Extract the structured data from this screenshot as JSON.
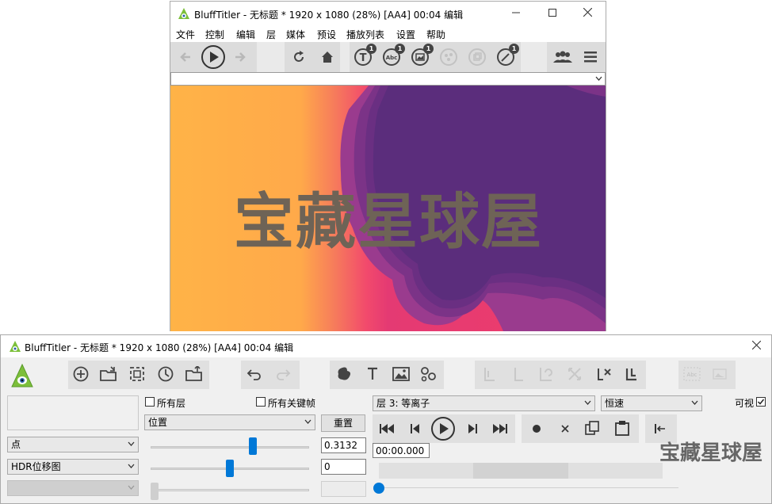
{
  "preview_window": {
    "title": "BluffTitler - 无标题 * 1920 x 1080 (28%) [AA4] 00:04 编辑",
    "menu": [
      "文件",
      "控制",
      "编辑",
      "层",
      "媒体",
      "预设",
      "播放列表",
      "设置",
      "帮助"
    ],
    "toolbar_badges": [
      "1",
      "1",
      "1",
      "1"
    ],
    "combo_value": ""
  },
  "watermark": "宝藏星球屋",
  "control_window": {
    "title": "BluffTitler - 无标题 * 1920 x 1080 (28%) [AA4] 00:04 编辑",
    "all_layers_label": "所有层",
    "all_keyframes_label": "所有关键帧",
    "property_select": "位置",
    "reset_button": "重置",
    "point_select": "点",
    "hdr_select": "HDR位移图",
    "value1": "0.3132",
    "value2": "0",
    "slider1_fraction": 0.65,
    "slider2_fraction": 0.5,
    "layer_select": "层 3: 等离子",
    "speed_select": "恒速",
    "visible_label": "可视",
    "visible_checked": true,
    "time_value": "00:00.000",
    "timeline_fraction": 0.0
  },
  "colors": {
    "accent": "#0078d7",
    "plasma_orange": "#ffb347",
    "plasma_pink": "#f2386e",
    "plasma_purple": "#5b2d7c"
  }
}
